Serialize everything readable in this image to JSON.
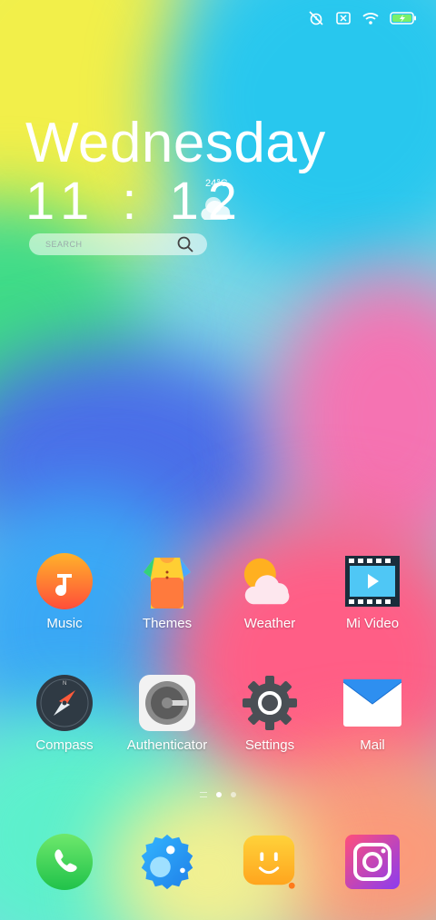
{
  "home": {
    "day": "Wednesday",
    "time": "11 : 12",
    "temperature": "24°C",
    "search_placeholder": "SEARCH"
  },
  "status_icons": [
    "alarm-off-icon",
    "sim-x-icon",
    "wifi-icon",
    "battery-charging-icon"
  ],
  "apps": [
    {
      "name": "Music"
    },
    {
      "name": "Themes"
    },
    {
      "name": "Weather"
    },
    {
      "name": "Mi Video"
    },
    {
      "name": "Compass"
    },
    {
      "name": "Authenticator"
    },
    {
      "name": "Settings"
    },
    {
      "name": "Mail"
    }
  ],
  "dock": [
    {
      "icon": "phone-icon"
    },
    {
      "icon": "messaging-icon"
    },
    {
      "icon": "smiley-icon"
    },
    {
      "icon": "camera-icon"
    }
  ],
  "page_indicator": {
    "pages": 2,
    "current": 1
  }
}
